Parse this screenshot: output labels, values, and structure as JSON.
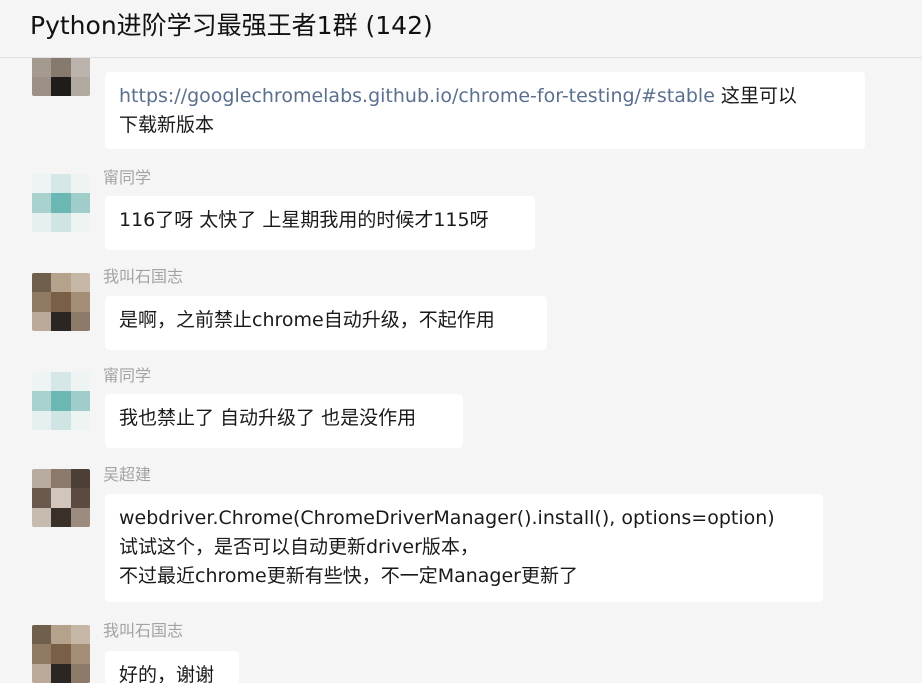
{
  "header": {
    "title": "Python进阶学习最强王者1群 (142)"
  },
  "messages": [
    {
      "sender": "",
      "lines": [
        {
          "link": "https://googlechromelabs.github.io/chrome-for-testing/#stable",
          "text": " 这里可以"
        },
        {
          "link": "",
          "text": "下载新版本"
        }
      ]
    },
    {
      "sender": "甯同学",
      "lines": [
        {
          "link": "",
          "text": "116了呀 太快了 上星期我用的时候才115呀"
        }
      ]
    },
    {
      "sender": "我叫石国志",
      "lines": [
        {
          "link": "",
          "text": "是啊，之前禁止chrome自动升级，不起作用"
        }
      ]
    },
    {
      "sender": "甯同学",
      "lines": [
        {
          "link": "",
          "text": "我也禁止了 自动升级了 也是没作用"
        }
      ]
    },
    {
      "sender": "吴超建",
      "lines": [
        {
          "link": "",
          "text": "webdriver.Chrome(ChromeDriverManager().install(), options=option)"
        },
        {
          "link": "",
          "text": "试试这个，是否可以自动更新driver版本，"
        },
        {
          "link": "",
          "text": "不过最近chrome更新有些快，不一定Manager更新了"
        }
      ]
    },
    {
      "sender": "我叫石国志",
      "lines": [
        {
          "link": "",
          "text": "好的，谢谢"
        }
      ]
    }
  ],
  "colors": {
    "background": "#f5f5f5",
    "bubble": "#ffffff",
    "link": "#5b6f8e",
    "sender": "#a3a3a3"
  }
}
